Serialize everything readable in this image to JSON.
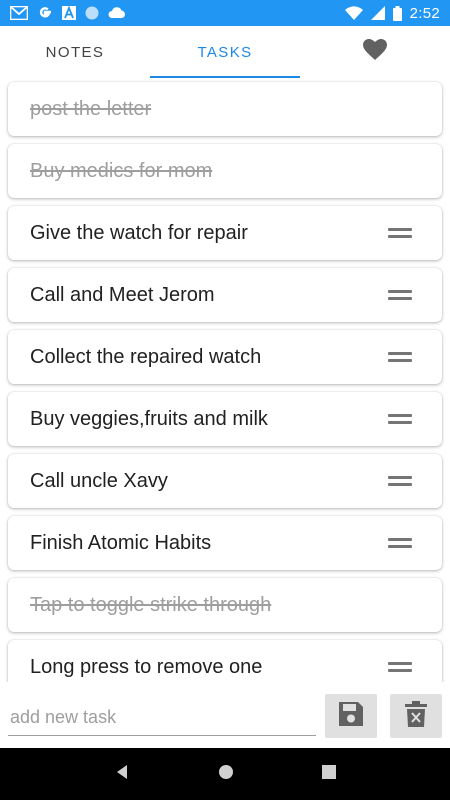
{
  "status_bar": {
    "time": "2:52",
    "icons_left": [
      "gmail-icon",
      "google-icon",
      "font-icon",
      "circle-icon",
      "cloud-icon"
    ],
    "icons_right": [
      "wifi-icon",
      "signal-icon",
      "battery-icon"
    ]
  },
  "tabs": [
    {
      "label": "NOTES",
      "active": false
    },
    {
      "label": "TASKS",
      "active": true
    },
    {
      "label": "",
      "icon": "heart-icon",
      "active": false
    }
  ],
  "tasks": [
    {
      "text": "post the letter",
      "done": true
    },
    {
      "text": "Buy medics for mom",
      "done": true
    },
    {
      "text": "Give the watch for repair",
      "done": false
    },
    {
      "text": "Call and Meet Jerom",
      "done": false
    },
    {
      "text": "Collect the repaired watch",
      "done": false
    },
    {
      "text": "Buy veggies,fruits and milk",
      "done": false
    },
    {
      "text": "Call uncle Xavy",
      "done": false
    },
    {
      "text": "Finish Atomic Habits",
      "done": false
    },
    {
      "text": "Tap to toggle strike through",
      "done": true
    },
    {
      "text": "Long press to remove one",
      "done": false
    }
  ],
  "input": {
    "placeholder": "add new task",
    "value": ""
  },
  "buttons": {
    "save_icon": "save-icon",
    "delete_icon": "delete-icon"
  },
  "colors": {
    "status_bar": "#2196f3",
    "accent": "#1e88e5",
    "done_text": "#9e9e9e"
  }
}
